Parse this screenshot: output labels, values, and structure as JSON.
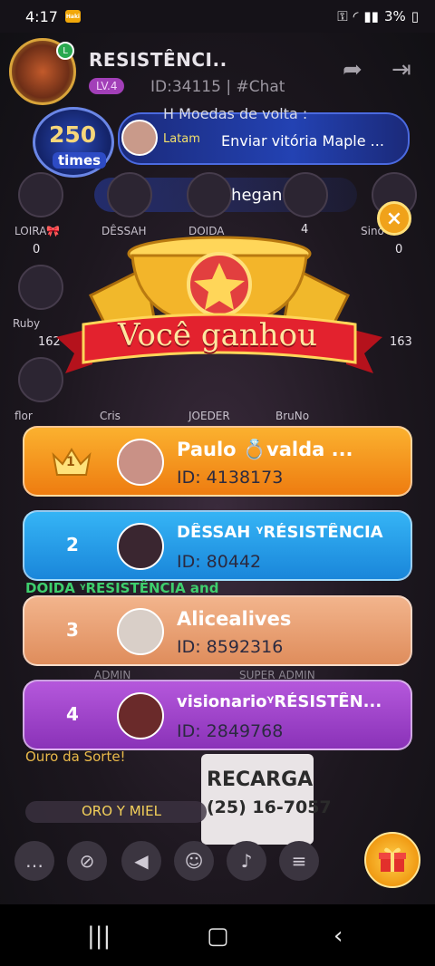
{
  "status_bar": {
    "time": "4:17",
    "app_badge": "Haki",
    "battery": "3%"
  },
  "room": {
    "name": "ꭿꭶ\nRESISTÊNCI..",
    "name_display": "RESISTÊNCI..",
    "level": "LV.4",
    "id_text": "ID:34115",
    "chat_tag": "| #Chat"
  },
  "banner": {
    "times_count": "250",
    "times_label": "times",
    "coins_back": "H Moedas de volta :",
    "latam_tag": "Latam",
    "send_text": "Enviar vitória Maple ..."
  },
  "arrival": {
    "text": "...chegando"
  },
  "seats": [
    {
      "name": "LOIRA🎀",
      "count": "0"
    },
    {
      "name": "DÊSSAH",
      "count": ""
    },
    {
      "name": "DOIDA",
      "count": ""
    },
    {
      "name": "",
      "count": "4"
    },
    {
      "name": "Sino",
      "count": "0"
    },
    {
      "name": "Ruby",
      "count": "162"
    },
    {
      "name": "",
      "count": "163"
    },
    {
      "name": "flor",
      "count": ""
    },
    {
      "name": "Cris",
      "count": ""
    },
    {
      "name": "JOEDER",
      "count": ""
    },
    {
      "name": "BruNo",
      "count": ""
    }
  ],
  "popup": {
    "title": "Você ganhou",
    "close_label": "×",
    "rankings": [
      {
        "position": "1",
        "name": "Paulo 💍valda ...",
        "id": "ID: 4138173",
        "color": "#f39a1e"
      },
      {
        "position": "2",
        "name": "DÊSSAH ᵞRÉSISTÊNCIA",
        "id": "ID: 80442",
        "color": "#1f9be6"
      },
      {
        "position": "3",
        "name": "Alicealives",
        "id": "ID: 8592316",
        "color": "#e79a6a"
      },
      {
        "position": "4",
        "name": "visionarioᵞRÉSISTÊN...",
        "id": "ID: 2849768",
        "color": "#9a3fc4"
      }
    ]
  },
  "chat": {
    "line1": "DOIDA ᵞRESISTÊNCIA and",
    "line2": "Ouro da Sorte!",
    "line3": "ORO Y MIEL",
    "admin1": "ADMIN",
    "admin2": "SUPER ADMIN"
  },
  "recarga": {
    "title": "RECARGA",
    "phone": "(25) 16-7057"
  },
  "bottom_bar": {
    "buttons": [
      "chat",
      "mic-off",
      "speaker",
      "emoji",
      "bell",
      "menu"
    ]
  }
}
